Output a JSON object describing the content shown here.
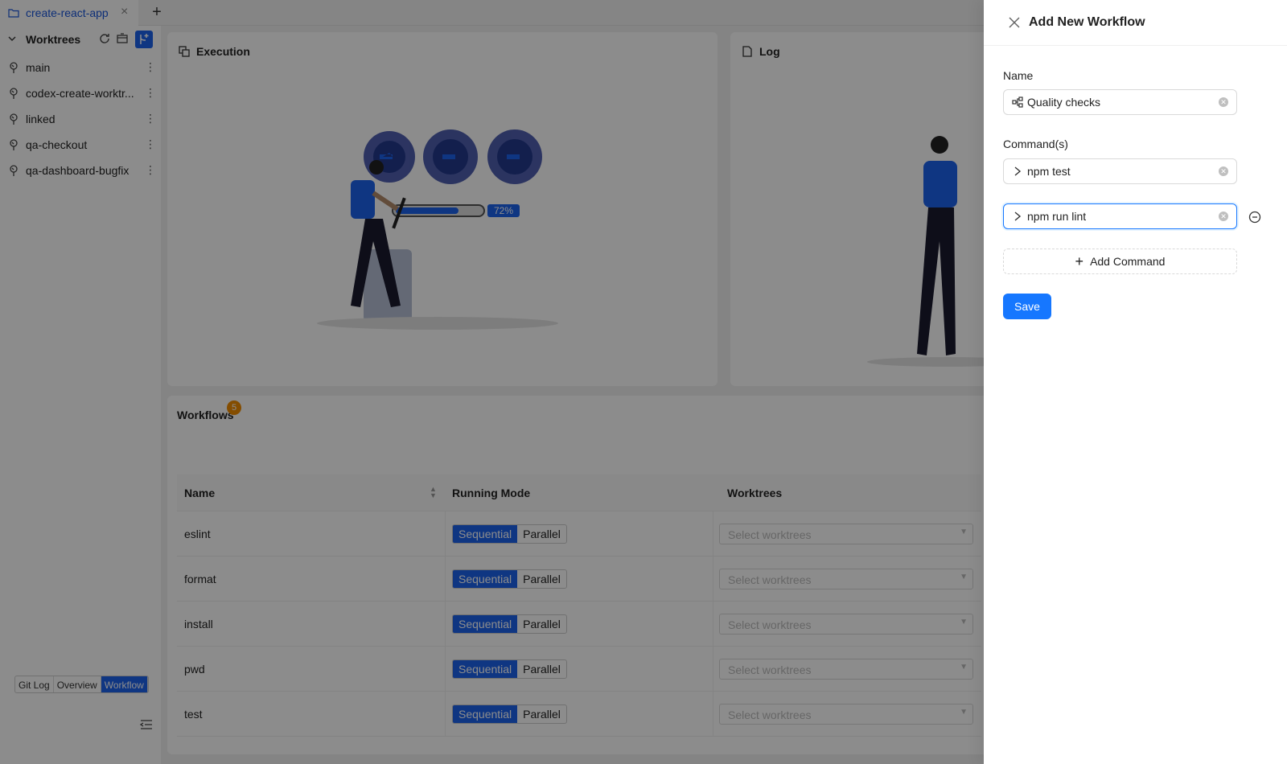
{
  "tabbar": {
    "tab_label": "create-react-app",
    "close_glyph": "×",
    "add_glyph": "+"
  },
  "sidebar": {
    "title": "Worktrees",
    "items": [
      {
        "label": "main"
      },
      {
        "label": "codex-create-worktr..."
      },
      {
        "label": "linked"
      },
      {
        "label": "qa-checkout"
      },
      {
        "label": "qa-dashboard-bugfix"
      }
    ],
    "nav": [
      "Git Log",
      "Overview",
      "Workflow"
    ],
    "nav_selected": "Workflow"
  },
  "panels": {
    "execution_title": "Execution",
    "execution_progress": "72%",
    "log_title": "Log"
  },
  "workflows": {
    "title": "Workflows",
    "count": "5",
    "columns": [
      "Name",
      "Running Mode",
      "Worktrees"
    ],
    "mode_options": [
      "Sequential",
      "Parallel"
    ],
    "worktree_placeholder": "Select worktrees",
    "rows": [
      {
        "name": "eslint",
        "mode": "Sequential"
      },
      {
        "name": "format",
        "mode": "Sequential"
      },
      {
        "name": "install",
        "mode": "Sequential"
      },
      {
        "name": "pwd",
        "mode": "Sequential"
      },
      {
        "name": "test",
        "mode": "Sequential"
      }
    ]
  },
  "drawer": {
    "title": "Add New Workflow",
    "name_label": "Name",
    "name_value": "Quality checks",
    "commands_label": "Command(s)",
    "commands": [
      "npm test",
      "npm run lint"
    ],
    "add_command_label": "Add Command",
    "save_label": "Save"
  },
  "colors": {
    "primary": "#1677ff",
    "accent": "#1d63ed",
    "badge": "#f08c00"
  }
}
